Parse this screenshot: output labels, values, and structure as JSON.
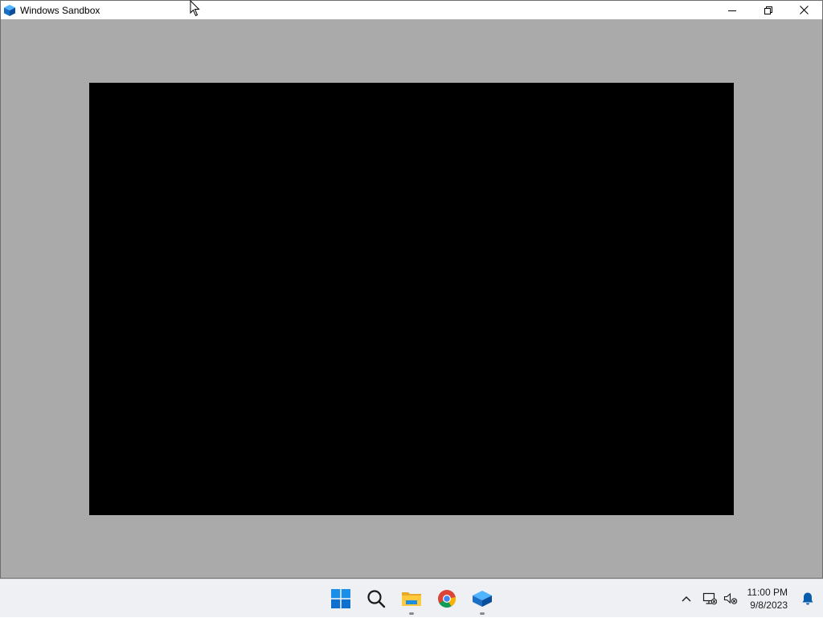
{
  "window": {
    "title": "Windows Sandbox",
    "icon": "sandbox-icon",
    "controls": [
      "minimize-icon",
      "restore-icon",
      "close-icon"
    ]
  },
  "guest": {
    "screen_color": "#000000",
    "background_color": "#aaaaaa"
  },
  "taskbar": {
    "items": [
      {
        "name": "start-button",
        "icon": "windows-logo-icon",
        "running": false
      },
      {
        "name": "search-button",
        "icon": "search-icon",
        "running": false
      },
      {
        "name": "file-explorer-button",
        "icon": "folder-icon",
        "running": true
      },
      {
        "name": "chrome-button",
        "icon": "chrome-icon",
        "running": false
      },
      {
        "name": "sandbox-button",
        "icon": "sandbox-icon",
        "running": true
      }
    ],
    "tray": {
      "overflow_icon": "chevron-up-icon",
      "network_icon": "network-disconnected-icon",
      "volume_icon": "volume-muted-icon",
      "notification_icon": "bell-icon"
    },
    "clock": {
      "time": "11:00 PM",
      "date": "9/8/2023"
    }
  },
  "colors": {
    "accent": "#0078d4",
    "taskbar_bg": "#eef0f3"
  }
}
